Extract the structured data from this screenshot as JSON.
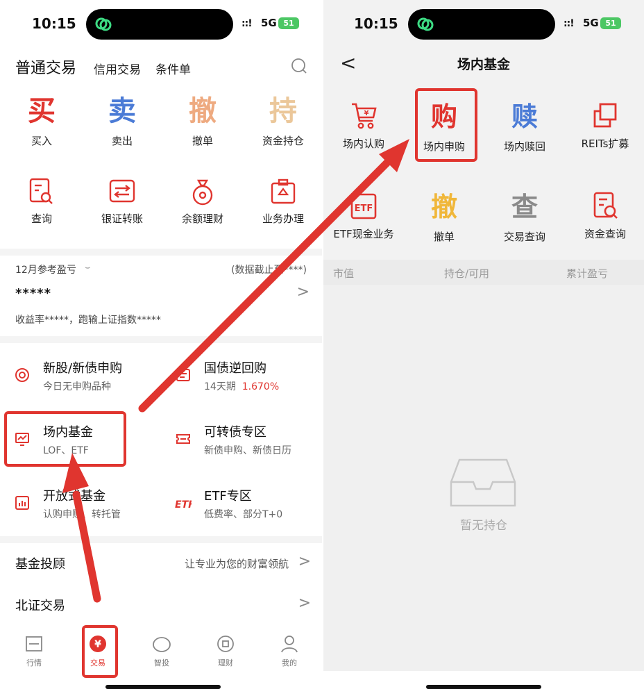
{
  "status_bar": {
    "time": "10:15",
    "network": "5G",
    "battery": "51",
    "signal": "::!"
  },
  "left": {
    "header": {
      "tab_normal": "普通交易",
      "tab_credit": "信用交易",
      "tab_condition": "条件单"
    },
    "grid": [
      {
        "glyph": "买",
        "label": "买入",
        "color": "#e0352f"
      },
      {
        "glyph": "卖",
        "label": "卖出",
        "color": "#4b7bd6"
      },
      {
        "glyph": "撤",
        "label": "撤单",
        "color": "#eeaa80"
      },
      {
        "glyph": "持",
        "label": "资金持仓",
        "color": "#ebc79a"
      },
      {
        "icon": "query-icon",
        "label": "查询"
      },
      {
        "icon": "bank-transfer-icon",
        "label": "银证转账"
      },
      {
        "icon": "money-bag-icon",
        "label": "余额理财"
      },
      {
        "icon": "briefcase-icon",
        "label": "业务办理"
      }
    ],
    "pnl": {
      "header": "12月参考盈亏",
      "eye": "⌣",
      "note": "(数据截止至****)",
      "masked_value": "*****",
      "rate_text": "收益率*****，跑输上证指数*****"
    },
    "menu": [
      {
        "title": "新股/新债申购",
        "subtitle": "今日无申购品种",
        "highlight": ""
      },
      {
        "title": "国债逆回购",
        "subtitle": "14天期",
        "highlight": "1.670%"
      },
      {
        "title": "场内基金",
        "subtitle": "LOF、ETF",
        "highlight": ""
      },
      {
        "title": "可转债专区",
        "subtitle": "新债申购、新债日历",
        "highlight": ""
      },
      {
        "title": "开放式基金",
        "subtitle": "认购申赎、转托管",
        "highlight": ""
      },
      {
        "title": "ETF专区",
        "subtitle": "低费率、部分T+0",
        "highlight": ""
      }
    ],
    "rows": [
      {
        "label": "基金投顾",
        "right": "让专业为您的财富领航"
      },
      {
        "label": "北证交易",
        "right": ""
      }
    ],
    "chevron": ">",
    "tabs": [
      {
        "label": "行情"
      },
      {
        "label": "交易"
      },
      {
        "label": "智投"
      },
      {
        "label": "理财"
      },
      {
        "label": "我的"
      }
    ],
    "trade_glyph": "¥"
  },
  "right": {
    "header": {
      "back": "<",
      "title": "场内基金"
    },
    "grid": [
      {
        "icon": "cart-icon",
        "label": "场内认购"
      },
      {
        "glyph": "购",
        "label": "场内申购",
        "color": "#e0352f"
      },
      {
        "glyph": "赎",
        "label": "场内赎回",
        "color": "#4b7bd6"
      },
      {
        "icon": "reits-icon",
        "label": "REITs扩募"
      },
      {
        "icon": "etf-icon",
        "label": "ETF现金业务",
        "etf_text": "ETF"
      },
      {
        "glyph": "撤",
        "label": "撤单",
        "color": "#f0b73a"
      },
      {
        "glyph": "查",
        "label": "交易查询",
        "color": "#8a8a8a"
      },
      {
        "icon": "fund-query-icon",
        "label": "资金查询"
      }
    ],
    "table_header": [
      "市值",
      "持仓/可用",
      "累计盈亏"
    ],
    "empty_text": "暂无持仓"
  },
  "accent_color": "#e0352f"
}
